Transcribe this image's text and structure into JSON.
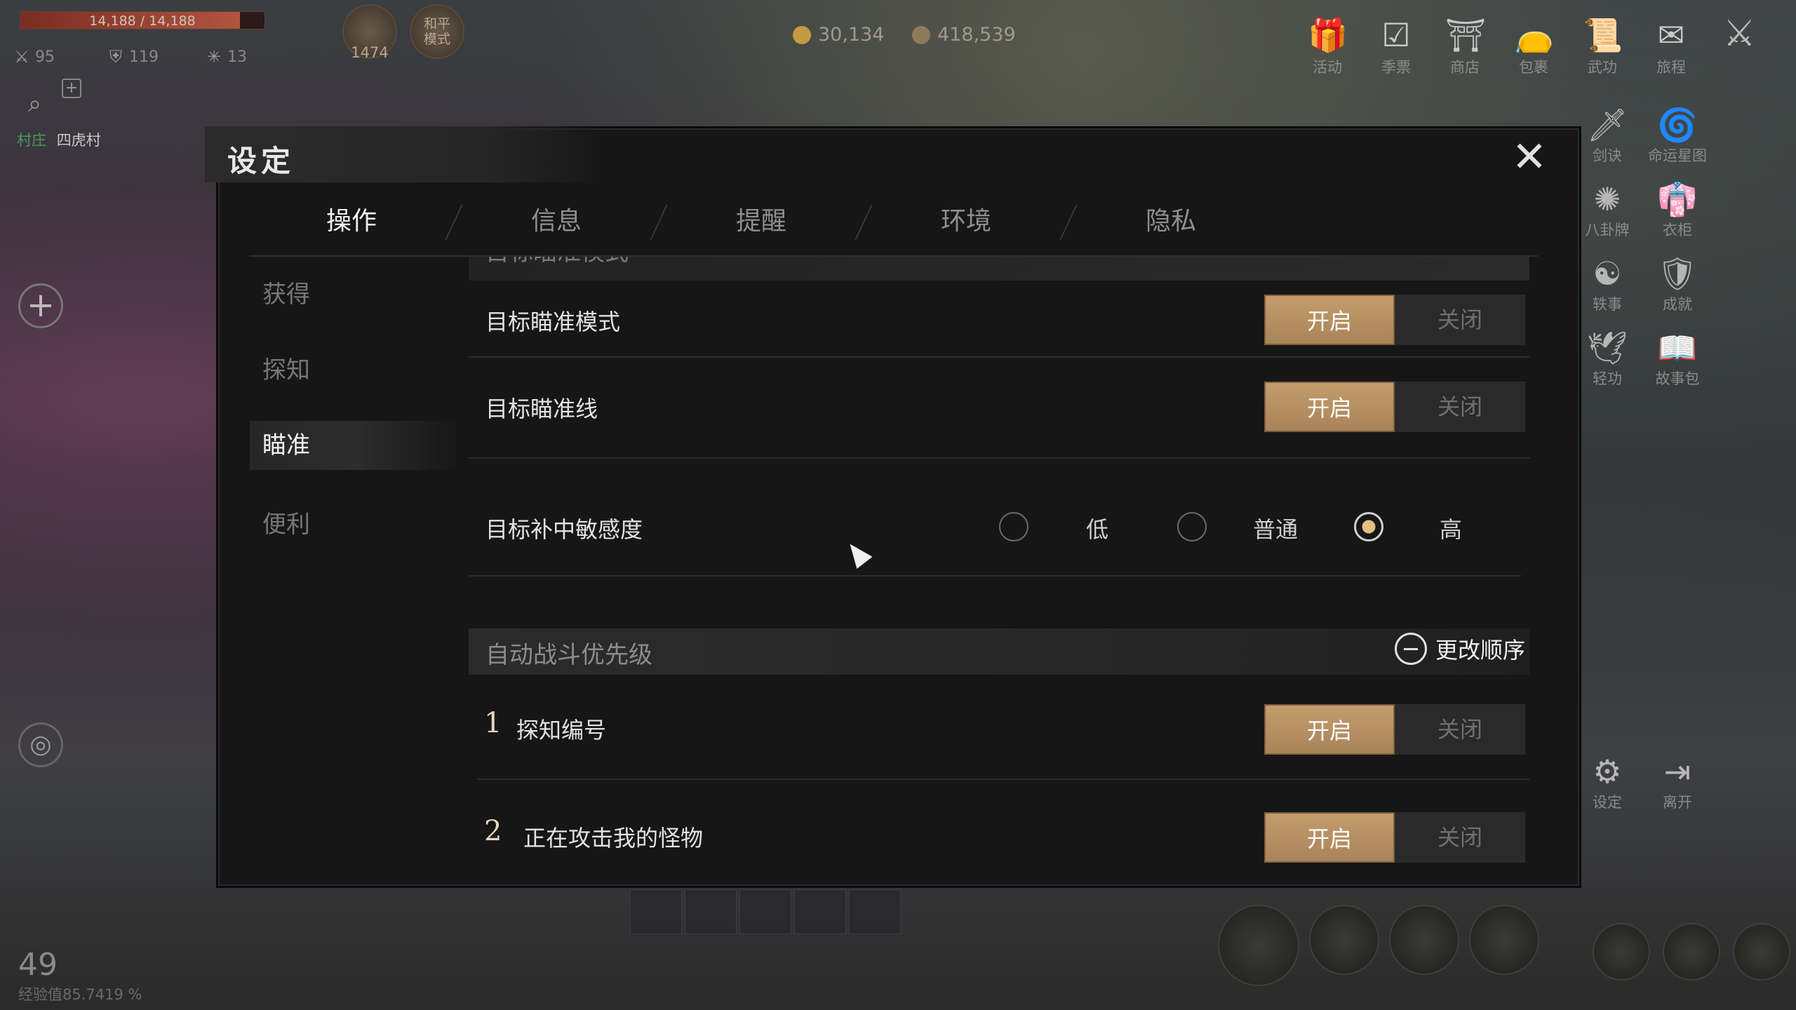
{
  "hud": {
    "hp_text": "14,188 / 14,188",
    "hp_fraction": 0.9,
    "stats": [
      {
        "icon": "crossed-swords-icon",
        "value": "95"
      },
      {
        "icon": "shield-icon",
        "value": "119"
      },
      {
        "icon": "star-burst-icon",
        "value": "13"
      }
    ],
    "badge_level": "1474",
    "mode_badge": "和平模式",
    "location_tag": "村庄",
    "location_name": "四虎村",
    "currency_1": "30,134",
    "currency_2": "418,539",
    "player_level": "49",
    "exp_text": "经验值85.7419 %"
  },
  "top_menu": [
    {
      "icon": "gift-icon",
      "label": "活动"
    },
    {
      "icon": "ticket-icon",
      "label": "季票"
    },
    {
      "icon": "shop-icon",
      "label": "商店"
    },
    {
      "icon": "bag-icon",
      "label": "包裹"
    },
    {
      "icon": "scroll-book-icon",
      "label": "武功"
    },
    {
      "icon": "journey-icon",
      "label": "旅程"
    }
  ],
  "side_menu": [
    {
      "icon": "sword-art-icon",
      "label": "剑诀"
    },
    {
      "icon": "swirl-icon",
      "label": "命运星图"
    },
    {
      "icon": "bagua-icon",
      "label": "八卦牌"
    },
    {
      "icon": "robe-icon",
      "label": "衣柜"
    },
    {
      "icon": "anecdote-icon",
      "label": "轶事"
    },
    {
      "icon": "achievement-icon",
      "label": "成就"
    },
    {
      "icon": "lightness-icon",
      "label": "轻功"
    },
    {
      "icon": "storybook-icon",
      "label": "故事包"
    },
    {
      "icon": "gear-icon",
      "label": "设定"
    },
    {
      "icon": "exit-icon",
      "label": "离开"
    }
  ],
  "settings": {
    "title": "设定",
    "tabs": [
      "操作",
      "信息",
      "提醒",
      "环境",
      "隐私"
    ],
    "active_tab": "操作",
    "subnav": [
      "获得",
      "探知",
      "瞄准",
      "便利"
    ],
    "active_subnav": "瞄准",
    "cut_header": "目标瞄准模式",
    "on_label": "开启",
    "off_label": "关闭",
    "rows": [
      {
        "label": "目标瞄准模式",
        "value": "开启"
      },
      {
        "label": "目标瞄准线",
        "value": "开启"
      }
    ],
    "sensitivity": {
      "label": "目标补中敏感度",
      "options": [
        "低",
        "普通",
        "高"
      ],
      "selected": "高"
    },
    "auto_battle": {
      "title": "自动战斗优先级",
      "reorder_label": "更改顺序",
      "items": [
        {
          "rank": "1",
          "label": "探知编号",
          "value": "开启"
        },
        {
          "rank": "2",
          "label": "正在攻击我的怪物",
          "value": "开启"
        }
      ]
    }
  }
}
